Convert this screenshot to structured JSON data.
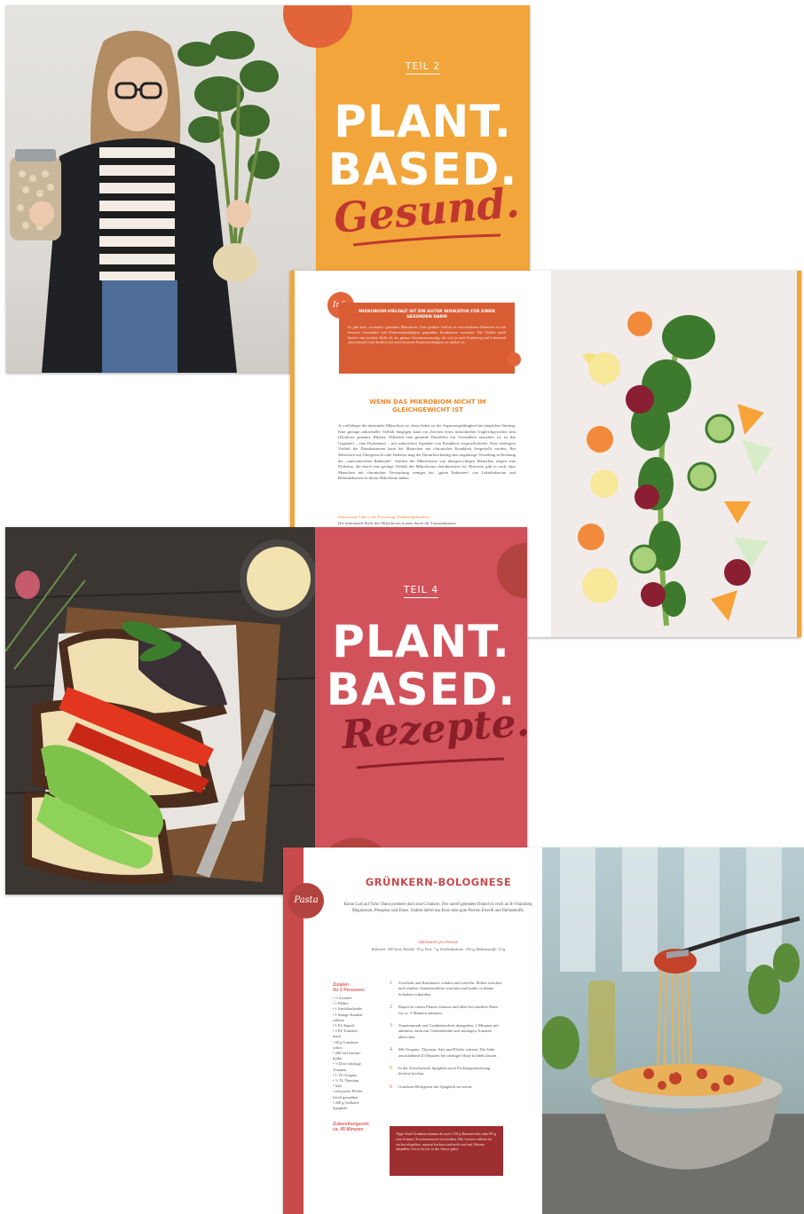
{
  "colors": {
    "orange": "#f1a53a",
    "coral_circle": "#e2643a",
    "pink": "#d1525a",
    "red_dark": "#b3433e",
    "recipe_red": "#c94a4b"
  },
  "spread1": {
    "teil": "TEIL 2",
    "title_line1": "PLANT.",
    "title_line2": "BASED.",
    "script": "Gesund."
  },
  "spread2": {
    "info_label": "Infa",
    "info_title": "MIKROBIOM-VIELFALT IST EIN GUTER INDIKATOR FÜR EINEN GESUNDEN DARM",
    "info_text": "Es gibt kein „normales“ gesundes Mikrobiom. Eine größere Vielfalt an verschiedenen Bakterien ist mit besserer Gesundheit und Widerstandsfähigkeit gegenüber Krankheiten assoziiert. Die Vielfalt spielt hierbei eine größere Rolle als die genaue Zusammensetzung, die sich je nach Ernährung und Lebensstil unterscheidet und deutlich mit einer besseren Funktionsfähigkeit zu stärken ist.",
    "section_title": "WENN DAS MIKROBIOM NICHT IM GLEICHGEWICHT IST",
    "body": "Je vielfältiger die intestinale Mikroflora ist, desto höher ist die Anpassungsfähigkeit bei möglicher Störung. Eine geringe mikrobielle Vielfalt hingegen kann ein Zeichen eines mikrobiellen Ungleichgewichts sein (Dysbiose genannt, Bilanz). Während eine gesunde Darmflora mit Gesundheit assoziiert ist, ist das Gegenteil – eine Dysbalance – mit zahlreichen Aspekten von Krankheit vergesellschaftet. Eine niedrigere Vielfalt der Darmbakterien kann bei Menschen mit chronischer Krankheit festgestellt werden. Bei Menschen mit Übergewicht oder Diabetes mag die Darmflora häufig eine ungünstige Verteilung in Richtung der „unerwünschten Bakterien“. Studien der Mikrobiome von übergewichtigen Menschen zeigen eine Dysbiose, die durch eine geringe Vielfalt des Mikrobioms charakterisiert ist. Hinweise gibt es auch, dass Menschen mit chronischer Verstopfung weniger der „guten Bakterien“ wie Laktobakterien und Bifidobakterien in ihrem Mikrobiom haben.",
    "highlight": "Interessante Fakt zu der Forschung: Ernährungsmedizin",
    "last_line": "Die bedeutende Rolle des Mikrobioms konnte durch die Transplantation"
  },
  "spread3": {
    "teil": "TEIL 4",
    "title_line1": "PLANT.",
    "title_line2": "BASED.",
    "script": "Rezepte."
  },
  "spread4": {
    "category": "Pasta",
    "title": "GRÜNKERN-BOLOGNESE",
    "intro": "Keine Lust auf Tofu? Dann probiere doch mal Grünkern. Der unreif geerntete Dinkel ist reich an B-Vitaminen, Magnesium, Phosphor und Eisen. Zudem liefert das Korn eine gute Portion Eiweiß und Ballaststoffe.",
    "nutrition_label": "Nährwerte pro Person",
    "nutrition": "Kalorien: 550 kcal, Eiweiß: 15 g, Fett: 7 g, Kohlenhydrate: 102 g, Ballaststoffe: 13 g",
    "ingredients_label_1": "Zutaten",
    "ingredients_label_2": "für 2 Personen:",
    "ingredients": [
      "• ½ Zwiebel",
      "• 1 Möhre",
      "• 1 Knoblauchzehe",
      "• 1 Stange Stauden-",
      "  sellerie",
      "• 1 EL Rapsöl",
      "• 2 EL Tomaten-",
      "  mark",
      "• 60 g Grünkern-",
      "  schrot",
      "• 200 ml Gemüse-",
      "  brühe",
      "• ½ Dose stückige",
      "  Tomaten",
      "• 1 TL Oregano",
      "• ½ TL Thymian",
      "• Salz",
      "• schwarzer Pfeffer",
      "  frisch gemahlen",
      "• 200 g Vollkorn-",
      "  Spaghetti"
    ],
    "prep_label_1": "Zubereitungszeit:",
    "prep_label_2": "ca. 45 Minuten",
    "steps": [
      {
        "n": "1",
        "text": "Zwiebeln und Knoblauch schälen und würfeln. Möhre waschen und schälen. Staudensellerie waschen und beides in dünne Scheiben schneiden."
      },
      {
        "n": "2",
        "text": "Rapsöl in einem Pfanne erhitzen und alles bei mittlerer Hitze für ca. 5 Minuten anbraten."
      },
      {
        "n": "3",
        "text": "Tomatenmark und Grünkernschrot dazugeben, 2 Minuten mit anbraten, dann mit Gemüsebrühe und stückigen Tomaten ablöschen."
      },
      {
        "n": "4",
        "text": "Mit Oregano, Thymian, Salz und Pfeffer würzen. Die Soße anschließend 20 Minuten bei niedriger Hitze köcheln lassen."
      },
      {
        "n": "5",
        "text": "In der Zwischenzeit Spaghetti nach Packungsanweisung bissfest kochen."
      },
      {
        "n": "6",
        "text": "Grünkern-Bolognese mit Spaghetti servieren."
      }
    ],
    "tip": "Tipp: Statt Grünkern kannst du auch 150 g Räuchertofu oder 80 g rote Linsen (Trockenmasse) verwenden. Die Linsen solltest du vorher abspülen, separat kochen und noch mal mit Wasser abspülen, bevor du sie in die Sauce gibst."
  }
}
